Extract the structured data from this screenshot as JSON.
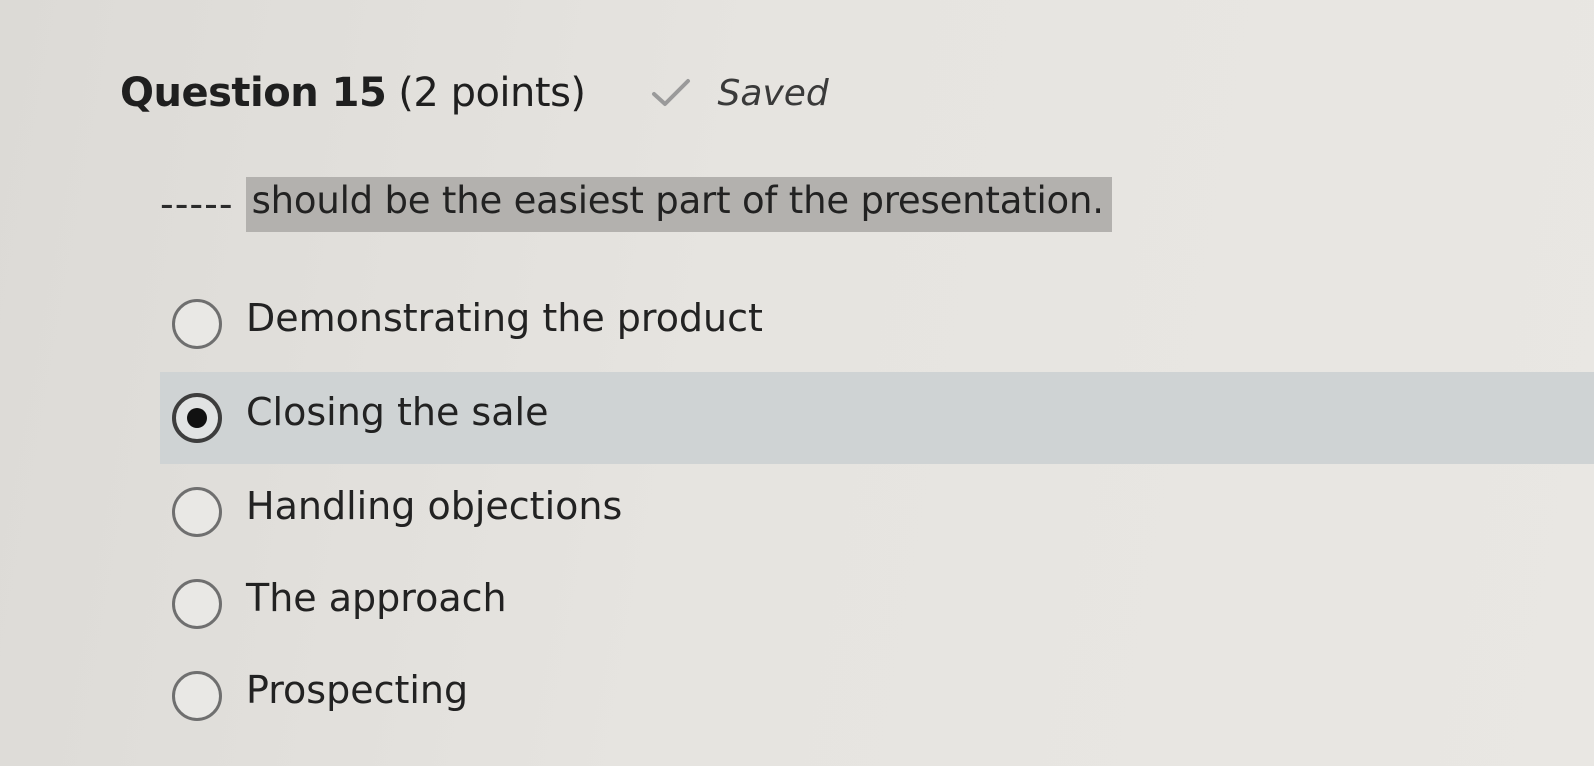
{
  "question": {
    "title": "Question 15",
    "points": "(2 points)",
    "saved_icon": "checkmark-icon",
    "saved_label": "Saved",
    "blank": "-----",
    "text": "should be the easiest part of the presentation."
  },
  "options": [
    {
      "label": "Demonstrating the product",
      "selected": false
    },
    {
      "label": "Closing the sale",
      "selected": true
    },
    {
      "label": "Handling objections",
      "selected": false
    },
    {
      "label": "The approach",
      "selected": false
    },
    {
      "label": "Prospecting",
      "selected": false
    }
  ],
  "colors": {
    "highlight": "#b3b1ae",
    "selected_row": "#cfd3d4",
    "text": "#222222"
  }
}
